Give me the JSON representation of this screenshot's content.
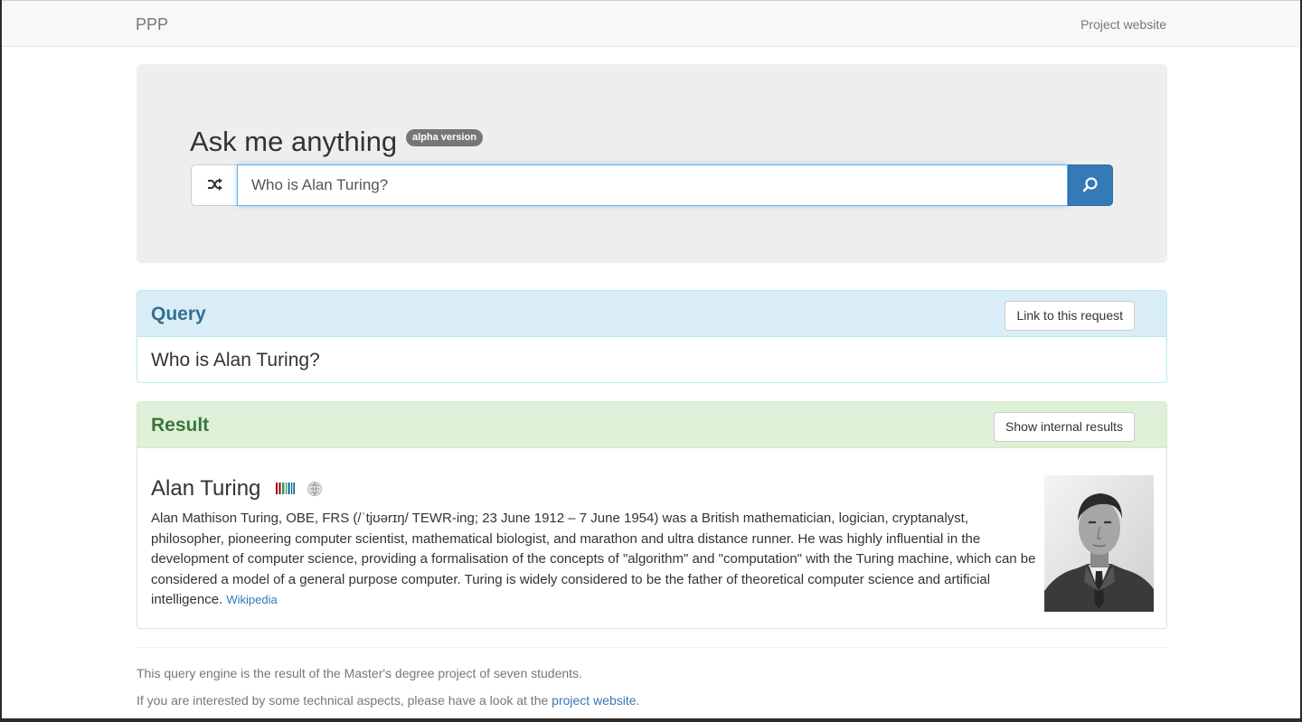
{
  "navbar": {
    "brand": "PPP",
    "project_link": "Project website"
  },
  "jumbotron": {
    "title": "Ask me anything",
    "badge": "alpha version"
  },
  "search": {
    "value": "Who is Alan Turing?",
    "shuffle_icon": "shuffle-icon",
    "submit_icon": "search-icon"
  },
  "query_panel": {
    "title": "Query",
    "link_button": "Link to this request",
    "query_text": "Who is Alan Turing?"
  },
  "result_panel": {
    "title": "Result",
    "internal_button": "Show internal results",
    "entity_name": "Alan Turing",
    "description": "Alan Mathison Turing, OBE, FRS (/ˈtjʊərɪŋ/ TEWR-ing; 23 June 1912 – 7 June 1954) was a British mathematician, logician, cryptanalyst, philosopher, pioneering computer scientist, mathematical biologist, and marathon and ultra distance runner. He was highly influential in the development of computer science, providing a formalisation of the concepts of \"algorithm\" and \"computation\" with the Turing machine, which can be considered a model of a general purpose computer. Turing is widely considered to be the father of theoretical computer science and artificial intelligence.",
    "source_link": "Wikipedia",
    "icons": [
      "wikidata-icon",
      "wikipedia-icon"
    ]
  },
  "footer": {
    "line1": "This query engine is the result of the Master's degree project of seven students.",
    "line2_prefix": "If you are interested by some technical aspects, please have a look at the ",
    "line2_link": "project website",
    "line2_suffix": "."
  },
  "colors": {
    "primary": "#337ab7",
    "info_bg": "#d9edf7",
    "success_bg": "#dff0d8",
    "jumbotron_bg": "#eeeeee"
  }
}
